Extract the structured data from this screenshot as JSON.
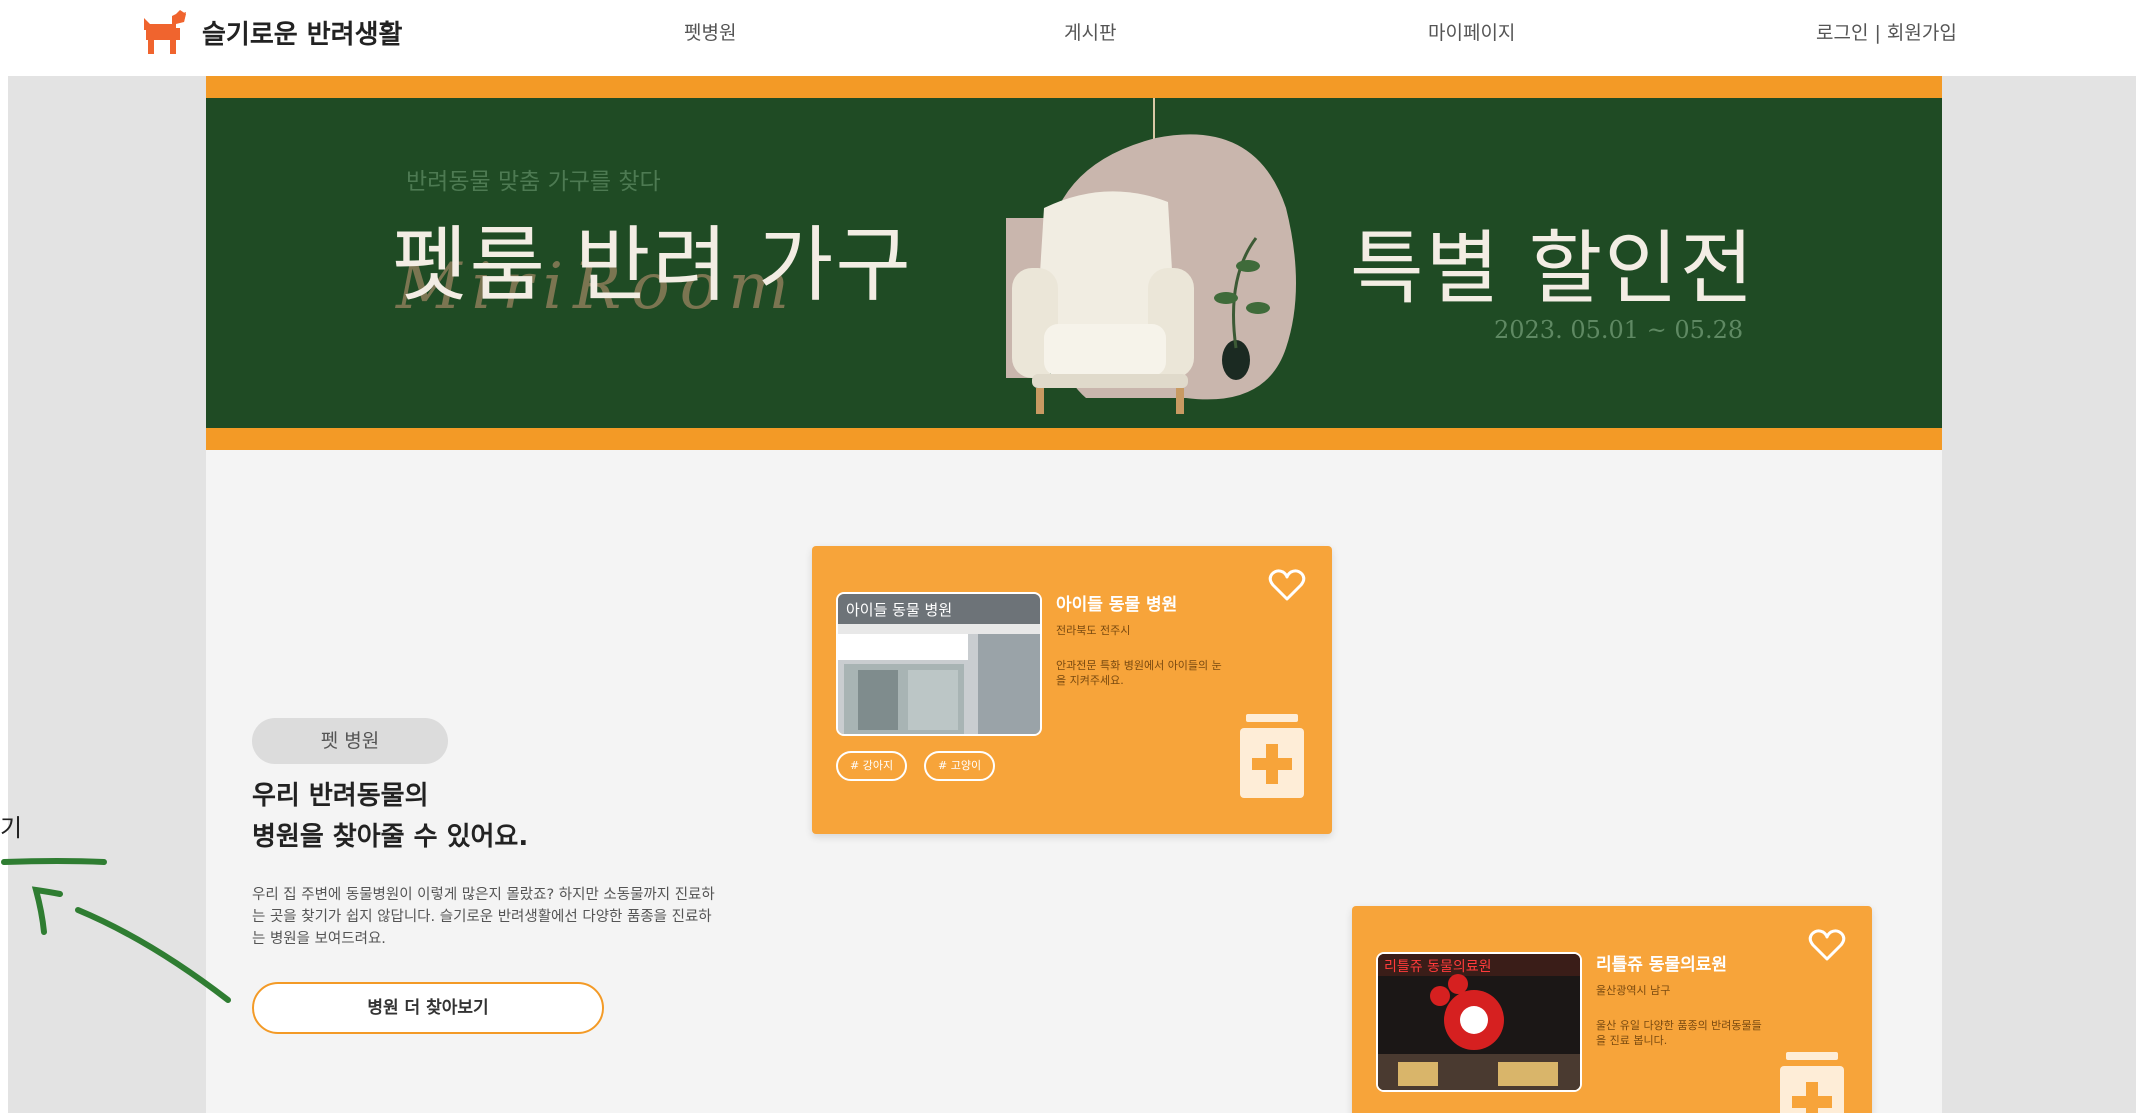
{
  "header": {
    "logo_text": "슬기로운 반려생활",
    "nav": [
      "펫병원",
      "게시판",
      "마이페이지"
    ],
    "auth": "로그인 | 회원가입"
  },
  "banner": {
    "subtitle": "반려동물 맞춤 가구를 찾다",
    "title": "펫룸 반려 가구",
    "script": "MiriRoom",
    "sale": "특별 할인전",
    "date": "2023. 05.01 ~ 05.28"
  },
  "section": {
    "pill": "펫 병원",
    "title_line1": "우리 반려동물의",
    "title_line2": "병원을 찾아줄 수 있어요.",
    "desc": "우리 집 주변에 동물병원이 이렇게 많은지 몰랐죠? 하지만 소동물까지 진료하는 곳을 찾기가 쉽지 않답니다. 슬기로운 반려생활에선 다양한 품종을 진료하는 병원을 보여드려요.",
    "button": "병원 더 찾아보기",
    "edge_text": "기"
  },
  "cards": [
    {
      "name": "아이들 동물 병원",
      "location": "전라북도 전주시",
      "desc": "안과전문 특화 병원에서 아이들의 눈을 지켜주세요.",
      "tags": [
        "# 강아지",
        "# 고양이"
      ],
      "image_sign": "아이들 동물 병원"
    },
    {
      "name": "리틀쥬 동물의료원",
      "location": "울산광역시 남구",
      "desc": "울산 유일 다양한 품종의 반려동물들을 진료 봅니다.",
      "image_sign": "리틀쥬 동물의료원"
    }
  ],
  "colors": {
    "accent": "#f39a26",
    "card": "#f7a43a",
    "banner": "#1f4b24",
    "arrow": "#2f7d32"
  }
}
